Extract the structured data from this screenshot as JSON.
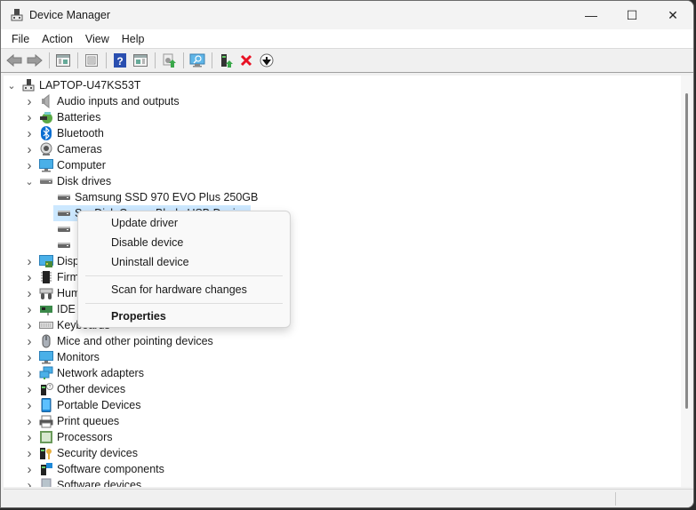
{
  "window": {
    "title": "Device Manager",
    "controls": {
      "minimize": "—",
      "maximize": "☐",
      "close": "✕"
    }
  },
  "menubar": [
    "File",
    "Action",
    "View",
    "Help"
  ],
  "toolbar": [
    {
      "name": "back-button",
      "icon": "back-arrow-icon"
    },
    {
      "name": "forward-button",
      "icon": "forward-arrow-icon"
    },
    {
      "name": "show-hide-console-tree-button",
      "icon": "console-tree-icon"
    },
    {
      "name": "properties-button",
      "icon": "properties-icon"
    },
    {
      "name": "help-button",
      "icon": "help-icon"
    },
    {
      "name": "show-action-pane-button",
      "icon": "action-pane-icon"
    },
    {
      "name": "update-driver-button",
      "icon": "update-driver-icon"
    },
    {
      "name": "scan-hardware-button",
      "icon": "scan-monitor-icon"
    },
    {
      "name": "enable-device-button",
      "icon": "enable-device-icon"
    },
    {
      "name": "uninstall-device-button",
      "icon": "red-x-icon"
    },
    {
      "name": "disable-device-button",
      "icon": "down-arrow-circle-icon"
    }
  ],
  "tree": {
    "root": "LAPTOP-U47KS53T",
    "categories": [
      {
        "label": "Audio inputs and outputs",
        "icon": "speaker-icon",
        "expanded": false
      },
      {
        "label": "Batteries",
        "icon": "battery-icon",
        "expanded": false
      },
      {
        "label": "Bluetooth",
        "icon": "bluetooth-icon",
        "expanded": false
      },
      {
        "label": "Cameras",
        "icon": "camera-icon",
        "expanded": false
      },
      {
        "label": "Computer",
        "icon": "computer-icon",
        "expanded": false
      },
      {
        "label": "Disk drives",
        "icon": "disk-drive-icon",
        "expanded": true,
        "children": [
          {
            "label": "Samsung SSD 970 EVO Plus 250GB",
            "selected": false
          },
          {
            "label": "SanDisk Cruzer Blade USB Device",
            "selected": true
          },
          {
            "label": "",
            "selected": false
          },
          {
            "label": "",
            "selected": false
          }
        ]
      },
      {
        "label": "Display adapters",
        "icon": "display-adapter-icon",
        "expanded": false
      },
      {
        "label": "Firmware",
        "icon": "firmware-chip-icon",
        "expanded": false
      },
      {
        "label": "Human Interface Devices",
        "icon": "hid-icon",
        "expanded": false
      },
      {
        "label": "IDE ATA/ATAPI controllers",
        "icon": "ide-controller-icon",
        "expanded": false
      },
      {
        "label": "Keyboards",
        "icon": "keyboard-icon",
        "expanded": false
      },
      {
        "label": "Mice and other pointing devices",
        "icon": "mouse-icon",
        "expanded": false
      },
      {
        "label": "Monitors",
        "icon": "monitor-icon",
        "expanded": false
      },
      {
        "label": "Network adapters",
        "icon": "network-adapter-icon",
        "expanded": false
      },
      {
        "label": "Other devices",
        "icon": "other-devices-icon",
        "expanded": false
      },
      {
        "label": "Portable Devices",
        "icon": "portable-device-icon",
        "expanded": false
      },
      {
        "label": "Print queues",
        "icon": "printer-icon",
        "expanded": false
      },
      {
        "label": "Processors",
        "icon": "processor-icon",
        "expanded": false
      },
      {
        "label": "Security devices",
        "icon": "security-device-icon",
        "expanded": false
      },
      {
        "label": "Software components",
        "icon": "software-component-icon",
        "expanded": false
      },
      {
        "label": "Software devices",
        "icon": "software-device-icon",
        "expanded": false
      }
    ]
  },
  "context_menu": {
    "items": [
      {
        "label": "Update driver",
        "bold": false
      },
      {
        "label": "Disable device",
        "bold": false
      },
      {
        "label": "Uninstall device",
        "bold": false
      },
      {
        "separator": true
      },
      {
        "label": "Scan for hardware changes",
        "bold": false
      },
      {
        "separator": true
      },
      {
        "label": "Properties",
        "bold": true
      }
    ]
  },
  "colors": {
    "selection": "#cce8ff",
    "window_bg": "#f0f0f0",
    "content_bg": "#ffffff",
    "red_x": "#e81123",
    "accent_blue": "#0078d4"
  }
}
